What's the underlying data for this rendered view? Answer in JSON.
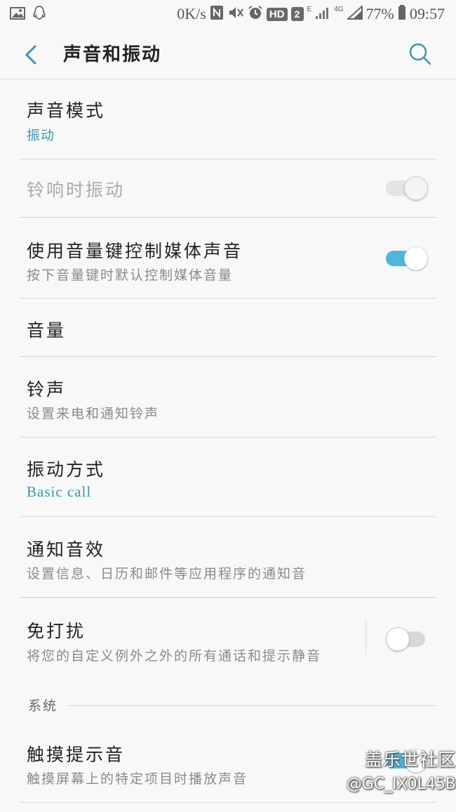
{
  "status_bar": {
    "speed": "0K/s",
    "hd": "HD",
    "sim": "2",
    "network_e": "E",
    "network_4g": "4G",
    "battery": "77%",
    "time": "09:57"
  },
  "header": {
    "title": "声音和振动"
  },
  "settings": {
    "sound_mode": {
      "title": "声音模式",
      "value": "振动"
    },
    "vibrate_when_ringing": {
      "title": "铃响时振动",
      "enabled": false,
      "on": true
    },
    "volume_keys_media": {
      "title": "使用音量键控制媒体声音",
      "subtitle": "按下音量键时默认控制媒体音量",
      "on": true
    },
    "volume": {
      "title": "音量"
    },
    "ringtone": {
      "title": "铃声",
      "subtitle": "设置来电和通知铃声"
    },
    "vibration_pattern": {
      "title": "振动方式",
      "value": "Basic call"
    },
    "notification_sound": {
      "title": "通知音效",
      "subtitle": "设置信息、日历和邮件等应用程序的通知音"
    },
    "do_not_disturb": {
      "title": "免打扰",
      "subtitle": "将您的自定义例外之外的所有通话和提示静音",
      "on": false
    },
    "system_section": {
      "label": "系统"
    },
    "touch_sounds": {
      "title": "触摸提示音",
      "subtitle": "触摸屏幕上的特定项目时播放声音"
    }
  },
  "watermark": {
    "brand": "盖乐世社区",
    "user": "@GC_IX0L45B"
  },
  "colors": {
    "accent": "#3d96ad",
    "switch_on": "#4fb6dc",
    "background": "#f8f8f8"
  }
}
